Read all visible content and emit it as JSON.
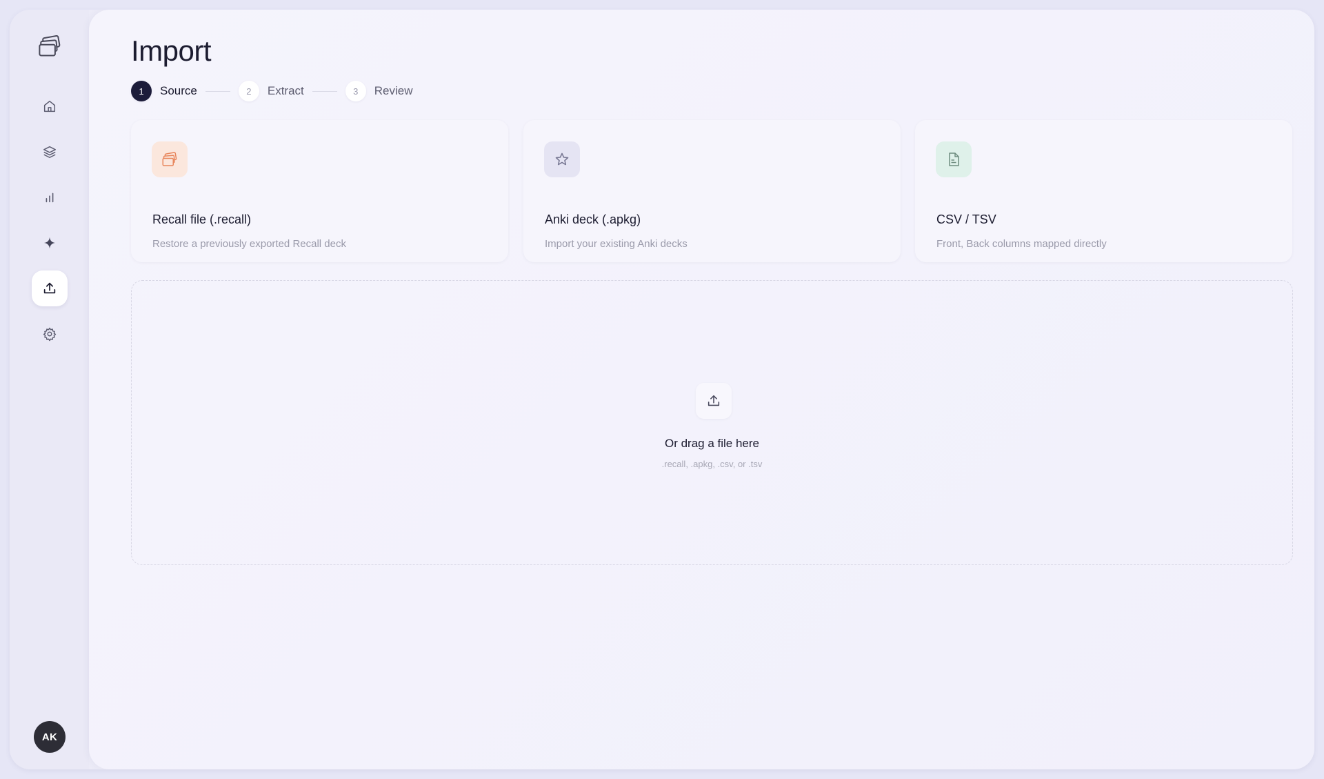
{
  "sidebar": {
    "logo_icon": "stacked-cards-icon",
    "items": [
      {
        "name": "home",
        "icon": "home-icon",
        "active": false
      },
      {
        "name": "decks",
        "icon": "layers-icon",
        "active": false
      },
      {
        "name": "stats",
        "icon": "bar-chart-icon",
        "active": false
      },
      {
        "name": "ai",
        "icon": "sparkle-icon",
        "active": false
      },
      {
        "name": "import",
        "icon": "upload-icon",
        "active": true
      },
      {
        "name": "settings",
        "icon": "gear-icon",
        "active": false
      }
    ],
    "avatar_initials": "AK"
  },
  "header": {
    "title": "Import"
  },
  "stepper": {
    "steps": [
      {
        "number": "1",
        "label": "Source",
        "active": true
      },
      {
        "number": "2",
        "label": "Extract",
        "active": false
      },
      {
        "number": "3",
        "label": "Review",
        "active": false
      }
    ]
  },
  "sources": [
    {
      "title": "Recall file (.recall)",
      "description": "Restore a previously exported Recall deck",
      "icon": "stacked-cards-icon",
      "icon_bg": "#fbe7dd",
      "icon_color": "#e8865c"
    },
    {
      "title": "Anki deck (.apkg)",
      "description": "Import your existing Anki decks",
      "icon": "star-icon",
      "icon_bg": "#e5e4f3",
      "icon_color": "#7a7a95"
    },
    {
      "title": "CSV / TSV",
      "description": "Front, Back columns mapped directly",
      "icon": "csv-file-icon",
      "icon_bg": "#dff1ea",
      "icon_color": "#6f8d80"
    }
  ],
  "dropzone": {
    "icon": "upload-icon",
    "text": "Or drag a file here",
    "hint": ".recall, .apkg, .csv, or .tsv"
  },
  "colors": {
    "accent_dark": "#1c1c3a",
    "background": "#ecebf7",
    "avatar": "#2d2d36"
  }
}
